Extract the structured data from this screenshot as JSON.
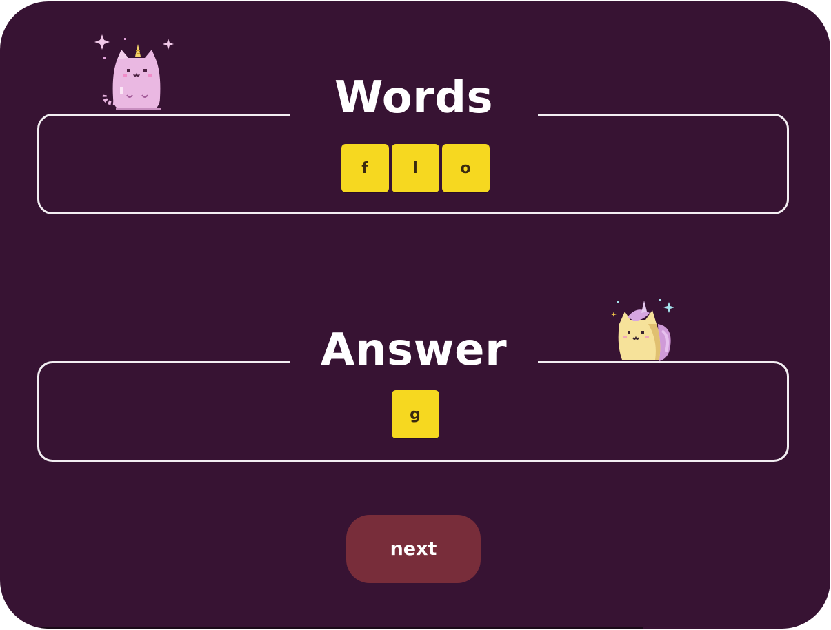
{
  "words_section": {
    "title": "Words",
    "tiles": [
      "f",
      "l",
      "o"
    ]
  },
  "answer_section": {
    "title": "Answer",
    "tiles": [
      "g"
    ]
  },
  "next_button": {
    "label": "next"
  },
  "colors": {
    "background": "#371333",
    "panel_border": "#f2eef2",
    "tile": "#f6d820",
    "button": "#782d3a"
  },
  "icons": {
    "words_mascot": "pink-unicorn-cat-icon",
    "answer_mascot": "yellow-unicorn-cat-icon"
  }
}
